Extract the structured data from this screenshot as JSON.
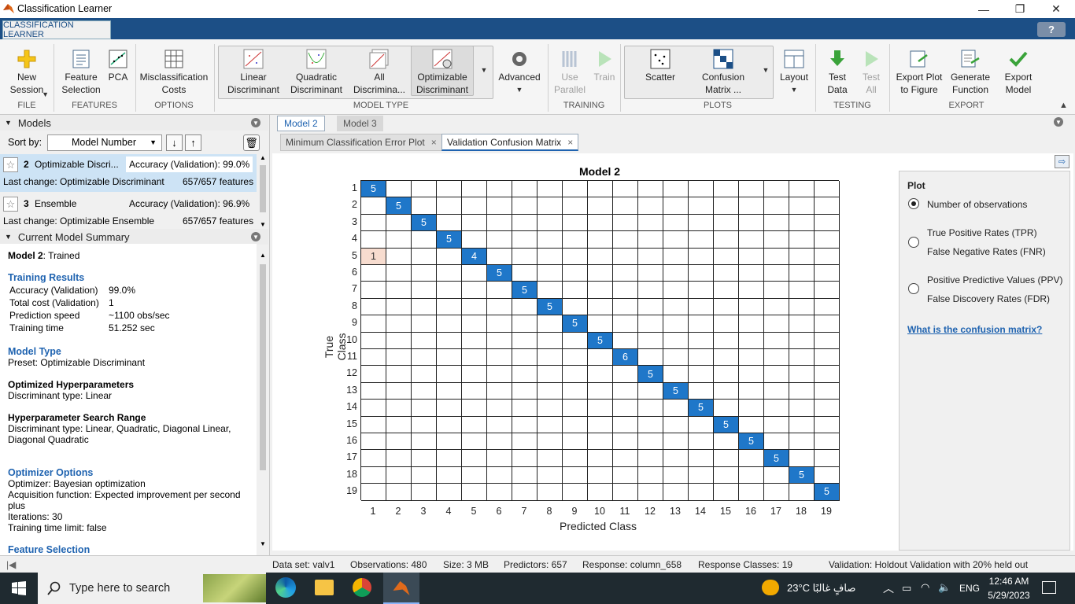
{
  "window": {
    "title": "Classification Learner",
    "minimize": "—",
    "restore": "❐",
    "close": "✕"
  },
  "app_tab": "CLASSIFICATION LEARNER",
  "help": "?",
  "ribbon": {
    "new_session": "New Session",
    "feature_selection": "Feature Selection",
    "pca": "PCA",
    "misclassification_costs": "Misclassification Costs",
    "linear_disc": "Linear Discriminant",
    "quadratic_disc": "Quadratic Discriminant",
    "all_disc": "All Discrimina...",
    "optimizable_disc": "Optimizable Discriminant",
    "advanced": "Advanced",
    "use_parallel": "Use Parallel",
    "train": "Train",
    "scatter": "Scatter",
    "confusion_matrix": "Confusion Matrix ...",
    "layout": "Layout",
    "test_data": "Test Data",
    "test_all": "Test All",
    "export_plot": "Export Plot to Figure",
    "generate_function": "Generate Function",
    "export_model": "Export Model",
    "groups": {
      "file": "FILE",
      "features": "FEATURES",
      "options": "OPTIONS",
      "model_type": "MODEL TYPE",
      "training": "TRAINING",
      "plots": "PLOTS",
      "testing": "TESTING",
      "export": "EXPORT"
    }
  },
  "models_panel": {
    "title": "Models",
    "sort_by": "Sort by:",
    "sort_value": "Model Number",
    "items": [
      {
        "num": "2",
        "name": "Optimizable Discri...",
        "accuracy": "Accuracy (Validation): 99.0%",
        "last_change": "Last change: Optimizable Discriminant",
        "features": "657/657 features"
      },
      {
        "num": "3",
        "name": "Ensemble",
        "accuracy": "Accuracy (Validation): 96.9%",
        "last_change": "Last change: Optimizable Ensemble",
        "features": "657/657 features"
      }
    ]
  },
  "summary": {
    "title": "Current Model Summary",
    "model_label": "Model 2",
    "model_state": ": Trained",
    "training_results": "Training Results",
    "tr": [
      {
        "k": "Accuracy (Validation)",
        "v": "99.0%"
      },
      {
        "k": "Total cost (Validation)",
        "v": "1"
      },
      {
        "k": "Prediction speed",
        "v": "~1100 obs/sec"
      },
      {
        "k": "Training time",
        "v": "51.252 sec"
      }
    ],
    "model_type": "Model Type",
    "preset": "Preset: Optimizable Discriminant",
    "opt_hyper": "Optimized Hyperparameters",
    "disc_type": "Discriminant type: Linear",
    "hyper_range": "Hyperparameter Search Range",
    "range_line1": "Discriminant type: Linear, Quadratic, Diagonal Linear,",
    "range_line2": "Diagonal Quadratic",
    "optimizer_options": "Optimizer Options",
    "optimizer": "Optimizer: Bayesian optimization",
    "acq1": "Acquisition function: Expected improvement per second",
    "acq2": "plus",
    "iterations": "Iterations: 30",
    "time_limit": "Training time limit: false",
    "feature_selection": "Feature Selection"
  },
  "doc_tabs": [
    "Model 2",
    "Model 3"
  ],
  "plot_tabs": [
    "Minimum Classification Error Plot",
    "Validation Confusion Matrix"
  ],
  "plot_options": {
    "title": "Plot",
    "opt1": "Number of observations",
    "opt2a": "True Positive Rates (TPR)",
    "opt2b": "False Negative Rates (FNR)",
    "opt3a": "Positive Predictive Values (PPV)",
    "opt3b": "False Discovery Rates (FDR)",
    "link": "What is the confusion matrix?"
  },
  "chart_data": {
    "type": "heatmap",
    "title": "Model 2",
    "xlabel": "Predicted Class",
    "ylabel": "True Class",
    "classes": [
      "1",
      "2",
      "3",
      "4",
      "5",
      "6",
      "7",
      "8",
      "9",
      "10",
      "11",
      "12",
      "13",
      "14",
      "15",
      "16",
      "17",
      "18",
      "19"
    ],
    "cells": [
      {
        "true": "1",
        "pred": "1",
        "value": 5
      },
      {
        "true": "2",
        "pred": "2",
        "value": 5
      },
      {
        "true": "3",
        "pred": "3",
        "value": 5
      },
      {
        "true": "4",
        "pred": "4",
        "value": 5
      },
      {
        "true": "5",
        "pred": "1",
        "value": 1
      },
      {
        "true": "5",
        "pred": "5",
        "value": 4
      },
      {
        "true": "6",
        "pred": "6",
        "value": 5
      },
      {
        "true": "7",
        "pred": "7",
        "value": 5
      },
      {
        "true": "8",
        "pred": "8",
        "value": 5
      },
      {
        "true": "9",
        "pred": "9",
        "value": 5
      },
      {
        "true": "10",
        "pred": "10",
        "value": 5
      },
      {
        "true": "11",
        "pred": "11",
        "value": 6
      },
      {
        "true": "12",
        "pred": "12",
        "value": 5
      },
      {
        "true": "13",
        "pred": "13",
        "value": 5
      },
      {
        "true": "14",
        "pred": "14",
        "value": 5
      },
      {
        "true": "15",
        "pred": "15",
        "value": 5
      },
      {
        "true": "16",
        "pred": "16",
        "value": 5
      },
      {
        "true": "17",
        "pred": "17",
        "value": 5
      },
      {
        "true": "18",
        "pred": "18",
        "value": 5
      },
      {
        "true": "19",
        "pred": "19",
        "value": 5
      }
    ],
    "colors": {
      "correct": "#1f77c9",
      "incorrect": "#f7dccf"
    }
  },
  "status": {
    "dataset": "Data set: valv1",
    "observations": "Observations: 480",
    "size": "Size: 3 MB",
    "predictors": "Predictors: 657",
    "response": "Response: column_658",
    "classes": "Response Classes: 19",
    "validation": "Validation: Holdout Validation with 20% held out"
  },
  "taskbar": {
    "search_placeholder": "Type here to search",
    "weather": "23°C  صافٍ غالبًا",
    "lang": "ENG",
    "time": "12:46 AM",
    "date": "5/29/2023"
  }
}
